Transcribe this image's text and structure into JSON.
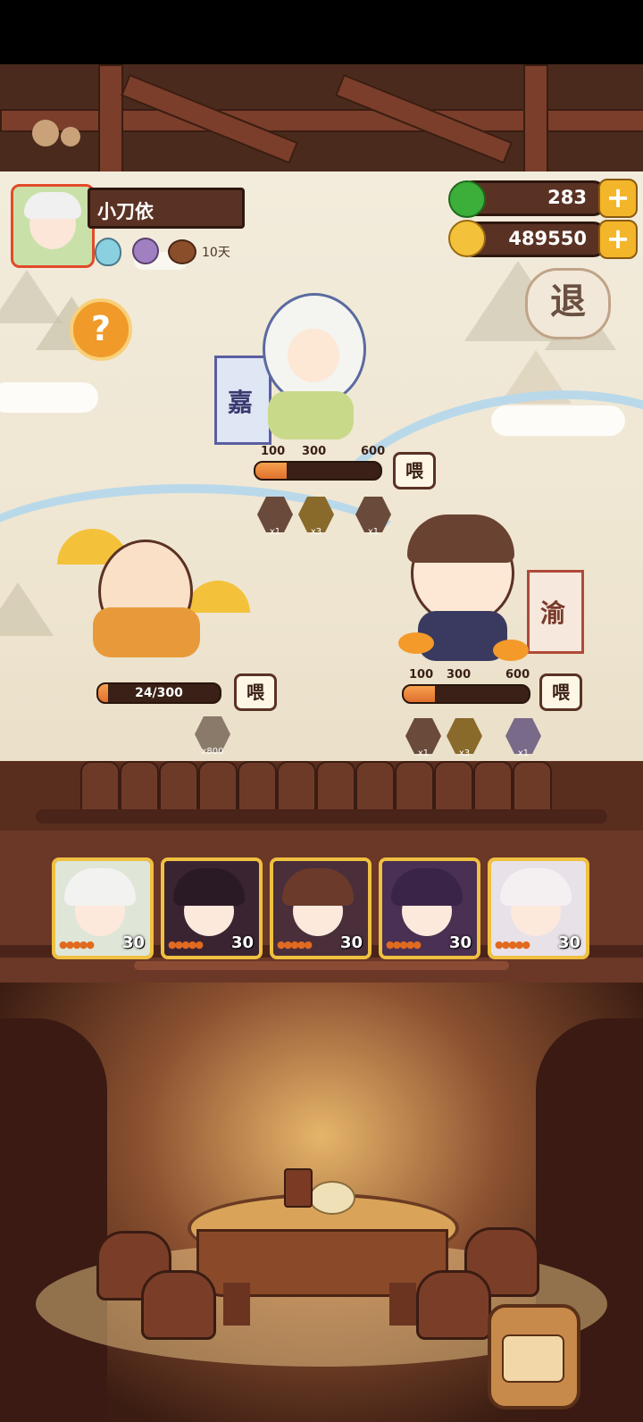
{
  "player": {
    "name": "小刀依",
    "days": "10天"
  },
  "currency": {
    "apple": "283",
    "coins": "489550",
    "plus": "+"
  },
  "controls": {
    "help": "?",
    "exit": "退"
  },
  "stations": [
    {
      "id": "top",
      "banner": "嘉",
      "ticks": [
        "100",
        "300",
        "600"
      ],
      "progress": 0.25,
      "feed": "喂",
      "rewards": [
        {
          "label": "x1"
        },
        {
          "label": "x3"
        },
        {
          "label": "x1"
        }
      ]
    },
    {
      "id": "left",
      "progress_text": "24/300",
      "progress": 0.08,
      "feed": "喂",
      "rewards": [
        {
          "label": "x800"
        }
      ]
    },
    {
      "id": "right",
      "banner": "渝",
      "ticks": [
        "100",
        "300",
        "600"
      ],
      "progress": 0.25,
      "feed": "喂",
      "rewards": [
        {
          "label": "x1"
        },
        {
          "label": "x3"
        },
        {
          "label": "x1"
        }
      ]
    }
  ],
  "heroes": [
    {
      "level": "30",
      "color": "#dfe6d8",
      "hair": "#f2f2f0"
    },
    {
      "level": "30",
      "color": "#3a2432",
      "hair": "#2a1a26"
    },
    {
      "level": "30",
      "color": "#4a2f3a",
      "hair": "#6b3a2a"
    },
    {
      "level": "30",
      "color": "#4a3052",
      "hair": "#3a2448"
    },
    {
      "level": "30",
      "color": "#e8e2e8",
      "hair": "#f4f0f2"
    }
  ],
  "colors": {
    "wood_dark": "#4a2a1c",
    "wood": "#6b3727",
    "gold": "#f0c040",
    "progress": "#e0702e"
  }
}
